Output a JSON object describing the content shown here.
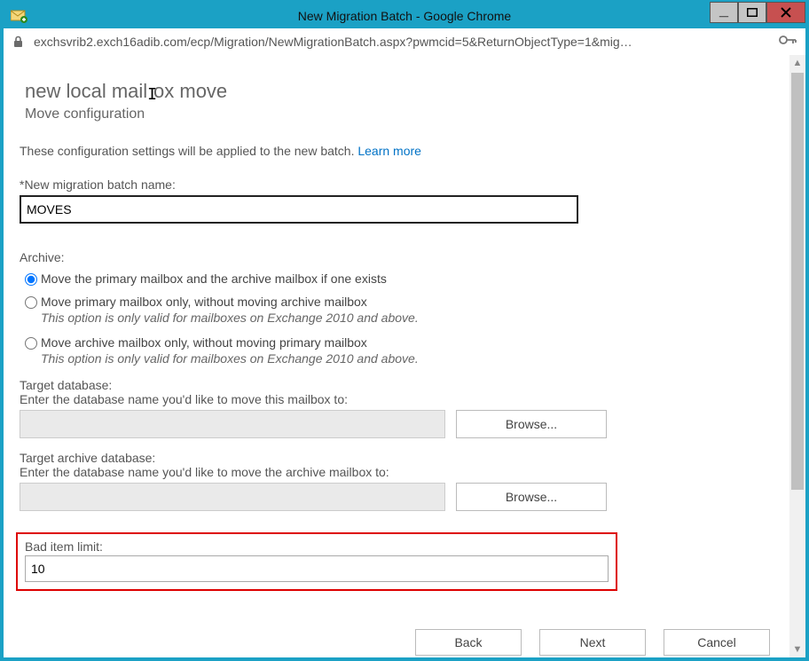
{
  "window": {
    "title": "New Migration Batch - Google Chrome",
    "controls": {
      "min": "—",
      "max": "☐",
      "close": "✕"
    }
  },
  "addressbar": {
    "url": "exchsvrib2.exch16adib.com/ecp/Migration/NewMigrationBatch.aspx?pwmcid=5&ReturnObjectType=1&mig…"
  },
  "page": {
    "title_pre": "new local mail",
    "title_post": "ox move",
    "subtitle": "Move configuration",
    "intro": "These configuration settings will be applied to the new batch.",
    "learn_more": "Learn more",
    "batch_name_label": "*New migration batch name:",
    "batch_name_value": "MOVES",
    "archive_label": "Archive:",
    "radios": [
      {
        "label": "Move the primary mailbox and the archive mailbox if one exists",
        "sub": ""
      },
      {
        "label": "Move primary mailbox only, without moving archive mailbox",
        "sub": "This option is only valid for mailboxes on Exchange 2010 and above."
      },
      {
        "label": "Move archive mailbox only, without moving primary mailbox",
        "sub": "This option is only valid for mailboxes on Exchange 2010 and above."
      }
    ],
    "target_db_label": "Target database:",
    "target_db_hint": "Enter the database name you'd like to move this mailbox to:",
    "target_archive_db_label": "Target archive database:",
    "target_archive_db_hint": "Enter the database name you'd like to move the archive mailbox to:",
    "browse_label": "Browse...",
    "bad_item_label": "Bad item limit:",
    "bad_item_value": "10"
  },
  "footer": {
    "back": "Back",
    "next": "Next",
    "cancel": "Cancel"
  }
}
